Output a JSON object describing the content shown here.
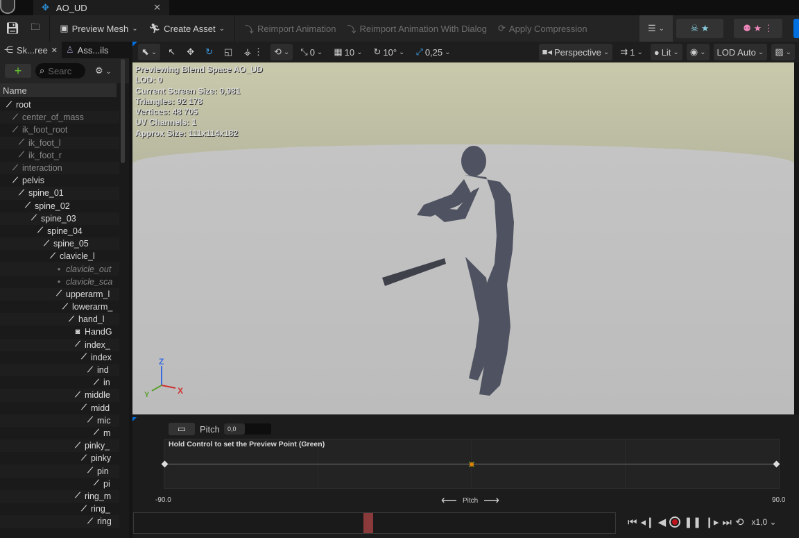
{
  "title_tab": {
    "label": "AO_UD"
  },
  "toolbar": {
    "preview_mesh": "Preview Mesh",
    "create_asset": "Create Asset",
    "reimport": "Reimport Animation",
    "reimport_dialog": "Reimport Animation With Dialog",
    "apply_compression": "Apply Compression"
  },
  "left_panel": {
    "tabs": [
      {
        "label": "Sk...ree"
      },
      {
        "label": "Ass...ils"
      }
    ],
    "search_placeholder": "Searc",
    "column_header": "Name",
    "tree": [
      {
        "label": "root",
        "level": 0,
        "style": "bone"
      },
      {
        "label": "center_of_mass",
        "level": 1,
        "style": "dim"
      },
      {
        "label": "ik_foot_root",
        "level": 1,
        "style": "dim"
      },
      {
        "label": "ik_foot_l",
        "level": 2,
        "style": "dim"
      },
      {
        "label": "ik_foot_r",
        "level": 2,
        "style": "dim"
      },
      {
        "label": "interaction",
        "level": 1,
        "style": "dim"
      },
      {
        "label": "pelvis",
        "level": 1,
        "style": "bone"
      },
      {
        "label": "spine_01",
        "level": 2,
        "style": "bone"
      },
      {
        "label": "spine_02",
        "level": 3,
        "style": "bone"
      },
      {
        "label": "spine_03",
        "level": 4,
        "style": "bone"
      },
      {
        "label": "spine_04",
        "level": 5,
        "style": "bone"
      },
      {
        "label": "spine_05",
        "level": 6,
        "style": "bone"
      },
      {
        "label": "clavicle_l",
        "level": 7,
        "style": "bone"
      },
      {
        "label": "clavicle_out",
        "level": 8,
        "style": "ital"
      },
      {
        "label": "clavicle_sca",
        "level": 8,
        "style": "ital"
      },
      {
        "label": "upperarm_l",
        "level": 8,
        "style": "bone"
      },
      {
        "label": "lowerarm_",
        "level": 9,
        "style": "bone"
      },
      {
        "label": "hand_l",
        "level": 10,
        "style": "bone"
      },
      {
        "label": "HandG",
        "level": 11,
        "style": "socket"
      },
      {
        "label": "index_",
        "level": 11,
        "style": "bone"
      },
      {
        "label": "index",
        "level": 12,
        "style": "bone"
      },
      {
        "label": "ind",
        "level": 13,
        "style": "bone"
      },
      {
        "label": "in",
        "level": 14,
        "style": "bone"
      },
      {
        "label": "middle",
        "level": 11,
        "style": "bone"
      },
      {
        "label": "midd",
        "level": 12,
        "style": "bone"
      },
      {
        "label": "mic",
        "level": 13,
        "style": "bone"
      },
      {
        "label": "m",
        "level": 14,
        "style": "bone"
      },
      {
        "label": "pinky_",
        "level": 11,
        "style": "bone"
      },
      {
        "label": "pinky",
        "level": 12,
        "style": "bone"
      },
      {
        "label": "pin",
        "level": 13,
        "style": "bone"
      },
      {
        "label": "pi",
        "level": 14,
        "style": "bone"
      },
      {
        "label": "ring_m",
        "level": 11,
        "style": "bone"
      },
      {
        "label": "ring_",
        "level": 12,
        "style": "bone"
      },
      {
        "label": "ring",
        "level": 13,
        "style": "bone"
      }
    ]
  },
  "viewport_toolbar": {
    "snap_translate": "0",
    "grid": "10",
    "rotate_snap": "10°",
    "scale_snap": "0,25",
    "view_mode": "Perspective",
    "speed": "1",
    "lighting": "Lit",
    "lod": "LOD Auto"
  },
  "stats": {
    "line1": "Previewing Blend Space AO_UD",
    "line2": "LOD: 0",
    "line3": "Current Screen Size: 0,981",
    "line4": "Triangles: 92 178",
    "line5": "Vertices: 48 705",
    "line6": "UV Channels: 1",
    "line7": "Approx Size: 111x114x182"
  },
  "axes": {
    "x": "X",
    "y": "Y",
    "z": "Z"
  },
  "blendspace": {
    "param_label": "Pitch",
    "param_value": "0,0",
    "hint": "Hold Control to set the Preview Point (Green)",
    "min": "-90.0",
    "max": "90.0",
    "axis_label": "Pitch",
    "preview_value": 0
  },
  "playback": {
    "speed": "x1,0",
    "position_fraction": 0.5
  },
  "colors": {
    "accent": "#0070e0",
    "record": "#c0141c",
    "scrub": "#8a3a3a"
  }
}
